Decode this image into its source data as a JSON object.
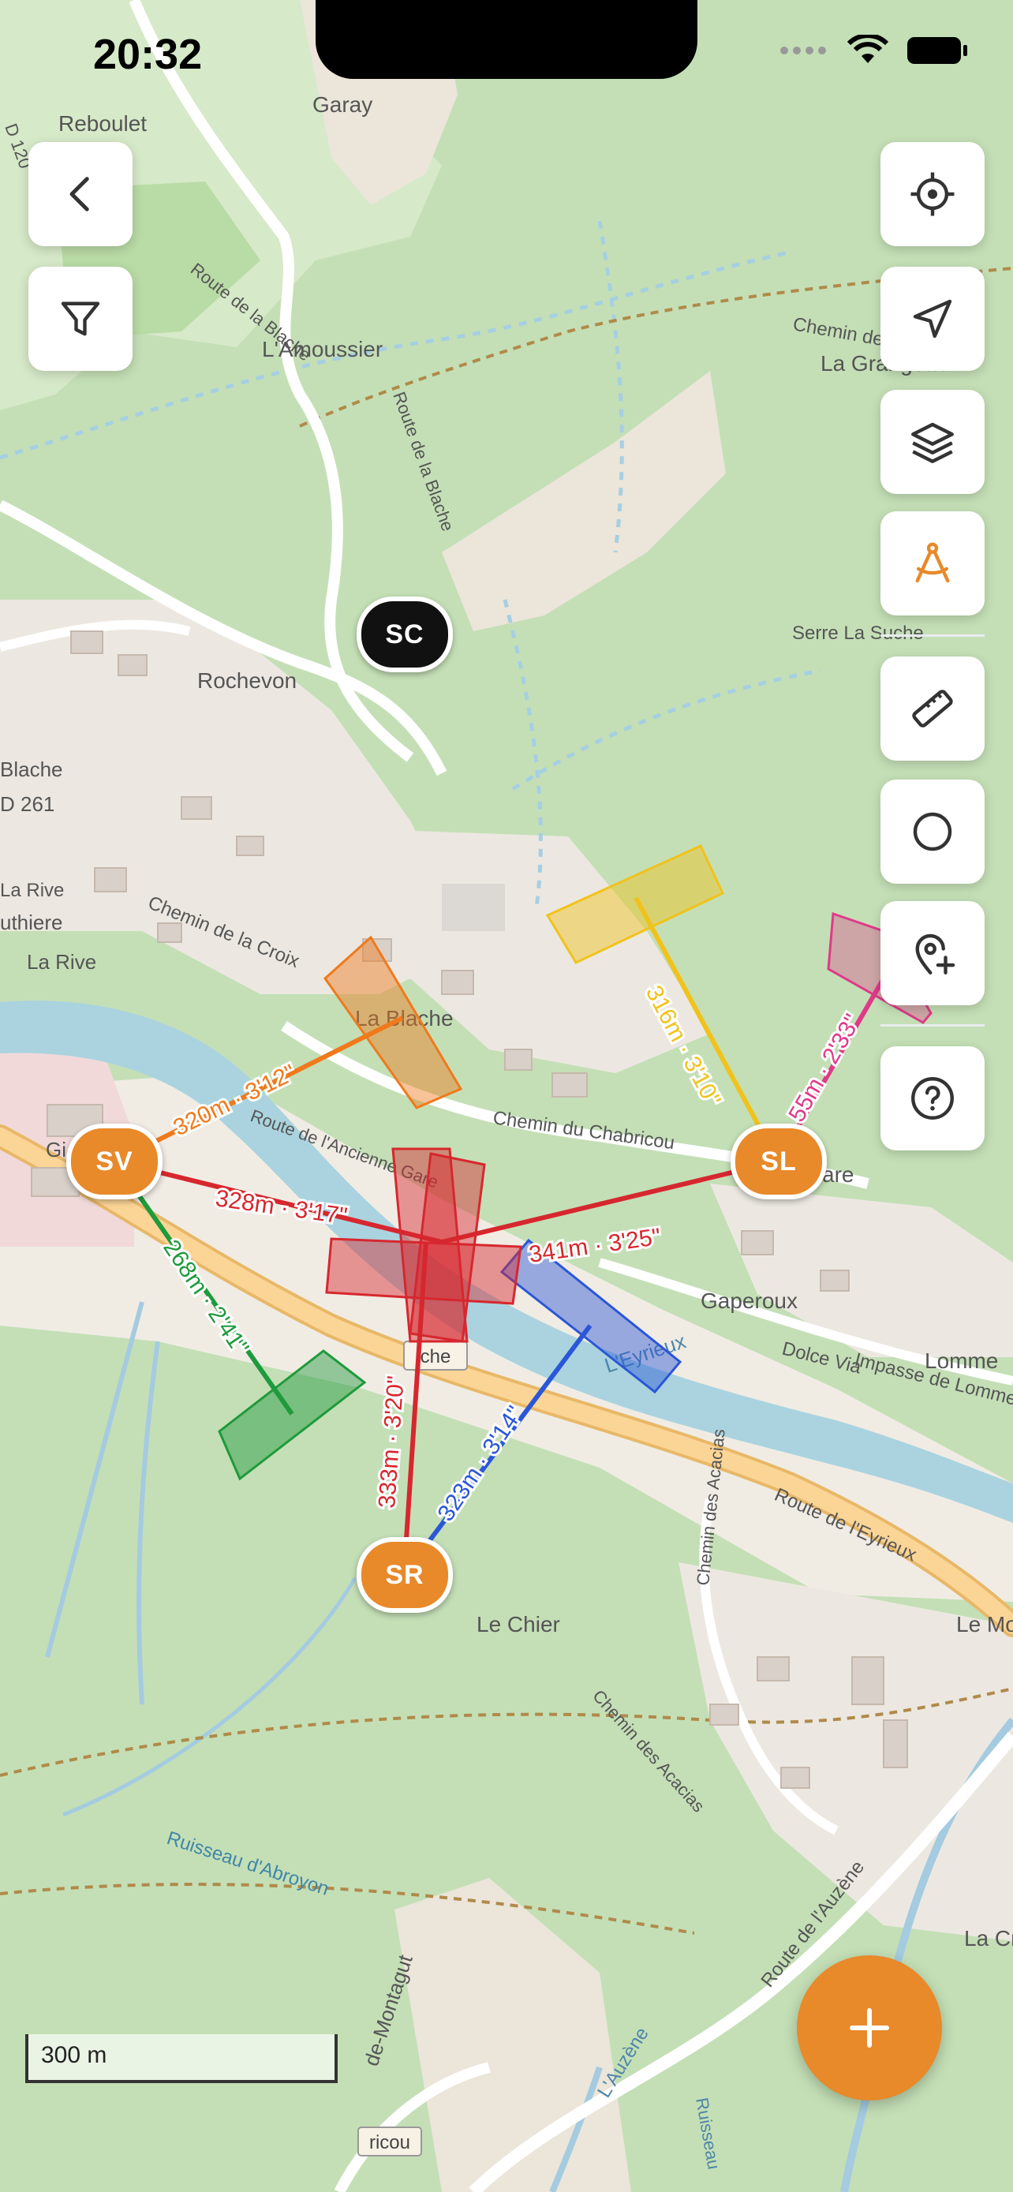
{
  "status": {
    "time": "20:32"
  },
  "map": {
    "place_labels": [
      "Garay",
      "Reboulet",
      "L'Amoussier",
      "Rochevon",
      "La Grangette",
      "Serre La Suche",
      "La Blache",
      "Gaperoux",
      "Lomme",
      "Le Chier",
      "Le Mo",
      "La Cr",
      "La Rive",
      "Chemin de la Croix",
      "Route de la Blache",
      "Route de l'Ancienne Gare",
      "Chemin du Chabricou",
      "Dolce Via",
      "Impasse de Lomme",
      "Route de l'Eyrieux",
      "Chemin des Acacias",
      "Route de l'Auzène",
      "Ruisseau d'Abroyon",
      "L'Eyrieux",
      "L'Auzène",
      "D 120",
      "D 261",
      "Blache",
      "uthiere",
      "che",
      "are",
      "Chemin de",
      "ricou",
      "Gi",
      "de-Montagut",
      "Ruisseau",
      "Chemin des Acacias"
    ],
    "scale_label": "300 m"
  },
  "stations": {
    "sc": "SC",
    "sv": "SV",
    "sl": "SL",
    "sr": "SR"
  },
  "measurements": {
    "sv_orange": "320m · 3'12\"",
    "sv_red": "328m · 3'17\"",
    "sv_green": "268m · 2'41\"",
    "sl_yellow": "316m · 3'10\"",
    "sl_red": "341m · 3'25\"",
    "sl_pink": "55m · 2'33\"",
    "sr_red": "333m · 3'20\"",
    "sr_blue": "323m · 3'14\""
  },
  "toolbar": {
    "left": [
      {
        "name": "back-button",
        "icon": "chevron-left-icon"
      },
      {
        "name": "filter-button",
        "icon": "filter-icon"
      }
    ],
    "right": [
      {
        "name": "locate-button",
        "icon": "crosshair-icon"
      },
      {
        "name": "navigate-button",
        "icon": "navigation-arrow-icon"
      },
      {
        "name": "layers-button",
        "icon": "layers-icon"
      },
      {
        "name": "compass-tool-button",
        "icon": "compass-drawing-icon",
        "active": true
      },
      {
        "name": "ruler-button",
        "icon": "ruler-icon"
      },
      {
        "name": "circle-button",
        "icon": "circle-icon"
      },
      {
        "name": "add-location-button",
        "icon": "pin-plus-icon"
      },
      {
        "name": "help-button",
        "icon": "question-icon"
      }
    ]
  },
  "fab": {
    "icon": "plus-icon"
  },
  "colors": {
    "accent": "#e8892a",
    "active_tool": "#e8892a",
    "line_red": "#d7272e",
    "line_orange": "#ef7a1c",
    "line_green": "#1f9a3c",
    "line_yellow": "#f1c21b",
    "line_blue": "#2a57d8",
    "line_pink": "#e0398a",
    "marker_dark": "#111111"
  }
}
